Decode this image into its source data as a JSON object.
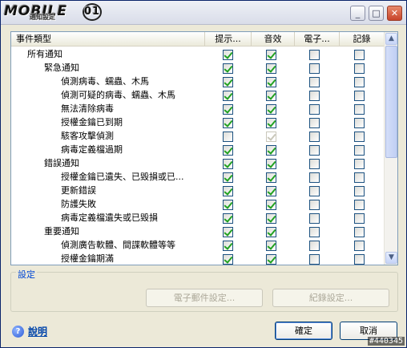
{
  "window": {
    "logo_text": "MOBILE",
    "logo_badge": "01",
    "logo_sub": "通知設定",
    "buttons": {
      "minimize": "_",
      "maximize": "□",
      "close": "✕"
    }
  },
  "table": {
    "columns": [
      "事件類型",
      "提示...",
      "音效",
      "電子...",
      "記錄"
    ],
    "rows": [
      {
        "label": "所有通知",
        "level": 0,
        "checks": [
          true,
          true,
          false,
          false
        ],
        "disabled": [
          false,
          false,
          false,
          false
        ]
      },
      {
        "label": "緊急通知",
        "level": 1,
        "checks": [
          true,
          true,
          false,
          false
        ],
        "disabled": [
          false,
          false,
          false,
          false
        ]
      },
      {
        "label": "偵測病毒、蠕蟲、木馬",
        "level": 2,
        "checks": [
          true,
          true,
          false,
          false
        ],
        "disabled": [
          false,
          false,
          false,
          false
        ]
      },
      {
        "label": "偵測可疑的病毒、蠕蟲、木馬",
        "level": 2,
        "checks": [
          true,
          true,
          false,
          false
        ],
        "disabled": [
          false,
          false,
          false,
          false
        ]
      },
      {
        "label": "無法清除病毒",
        "level": 2,
        "checks": [
          true,
          true,
          false,
          false
        ],
        "disabled": [
          false,
          false,
          false,
          false
        ]
      },
      {
        "label": "授權金鑰已到期",
        "level": 2,
        "checks": [
          true,
          true,
          false,
          false
        ],
        "disabled": [
          false,
          false,
          false,
          false
        ]
      },
      {
        "label": "駭客攻擊偵測",
        "level": 2,
        "checks": [
          false,
          true,
          false,
          false
        ],
        "disabled": [
          false,
          true,
          false,
          false
        ]
      },
      {
        "label": "病毒定義檔過期",
        "level": 2,
        "checks": [
          true,
          true,
          false,
          false
        ],
        "disabled": [
          false,
          false,
          false,
          false
        ]
      },
      {
        "label": "錯誤通知",
        "level": 1,
        "checks": [
          true,
          true,
          false,
          false
        ],
        "disabled": [
          false,
          false,
          false,
          false
        ]
      },
      {
        "label": "授權金鑰已遺失、已毀損或已...",
        "level": 2,
        "checks": [
          true,
          true,
          false,
          false
        ],
        "disabled": [
          false,
          false,
          false,
          false
        ]
      },
      {
        "label": "更新錯誤",
        "level": 2,
        "checks": [
          true,
          true,
          false,
          false
        ],
        "disabled": [
          false,
          false,
          false,
          false
        ]
      },
      {
        "label": "防護失敗",
        "level": 2,
        "checks": [
          true,
          true,
          false,
          false
        ],
        "disabled": [
          false,
          false,
          false,
          false
        ]
      },
      {
        "label": "病毒定義檔遺失或已毀損",
        "level": 2,
        "checks": [
          true,
          true,
          false,
          false
        ],
        "disabled": [
          false,
          false,
          false,
          false
        ]
      },
      {
        "label": "重要通知",
        "level": 1,
        "checks": [
          true,
          true,
          false,
          false
        ],
        "disabled": [
          false,
          false,
          false,
          false
        ]
      },
      {
        "label": "偵測廣告軟體、間諜軟體等等",
        "level": 2,
        "checks": [
          true,
          true,
          false,
          false
        ],
        "disabled": [
          false,
          false,
          false,
          false
        ]
      },
      {
        "label": "授權金鑰期滿",
        "level": 2,
        "checks": [
          true,
          true,
          false,
          false
        ],
        "disabled": [
          false,
          false,
          false,
          false
        ]
      }
    ]
  },
  "scrollbar": {
    "up": "▲",
    "down": "▼"
  },
  "settings_group": {
    "title": "設定",
    "email_button": "電子郵件設定...",
    "log_button": "紀錄設定..."
  },
  "footer": {
    "help_icon": "?",
    "help_label": "說明",
    "ok_label": "確定",
    "cancel_label": "取消"
  },
  "watermark": "#440345"
}
